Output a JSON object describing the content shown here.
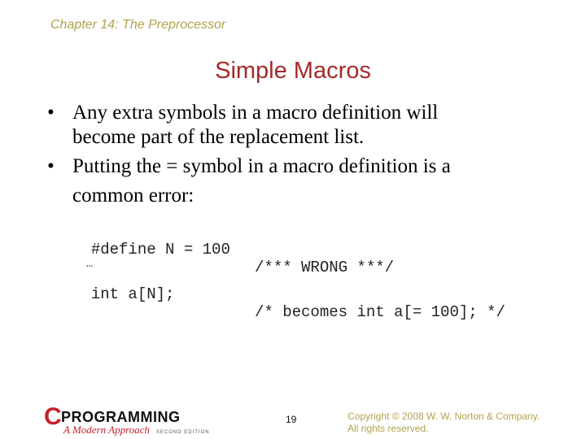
{
  "header": {
    "chapter": "Chapter 14: The Preprocessor"
  },
  "slide": {
    "title": "Simple Macros",
    "bullets": [
      {
        "marker": "•",
        "lines": [
          "Any extra symbols in a macro definition will",
          "become part of the replacement list."
        ]
      },
      {
        "marker": "•",
        "lines": [
          "Putting the = symbol in a macro definition is a",
          "common error:"
        ]
      }
    ],
    "code": [
      {
        "code": "#define N = 100",
        "comment": "/*** WRONG ***/"
      },
      {
        "code": "…",
        "comment": ""
      },
      {
        "code": "int a[N];",
        "comment": "/* becomes int a[= 100]; */"
      }
    ]
  },
  "footer": {
    "logo": {
      "letter": "C",
      "word": "PROGRAMMING",
      "subtitle": "A Modern Approach",
      "edition": "SECOND EDITION"
    },
    "page_number": "19",
    "copyright_lines": [
      "Copyright © 2008 W. W. Norton & Company.",
      "All rights reserved."
    ]
  },
  "colors": {
    "title": "#a52a2a",
    "header": "#b1a24e",
    "logo_red": "#c8202a"
  }
}
